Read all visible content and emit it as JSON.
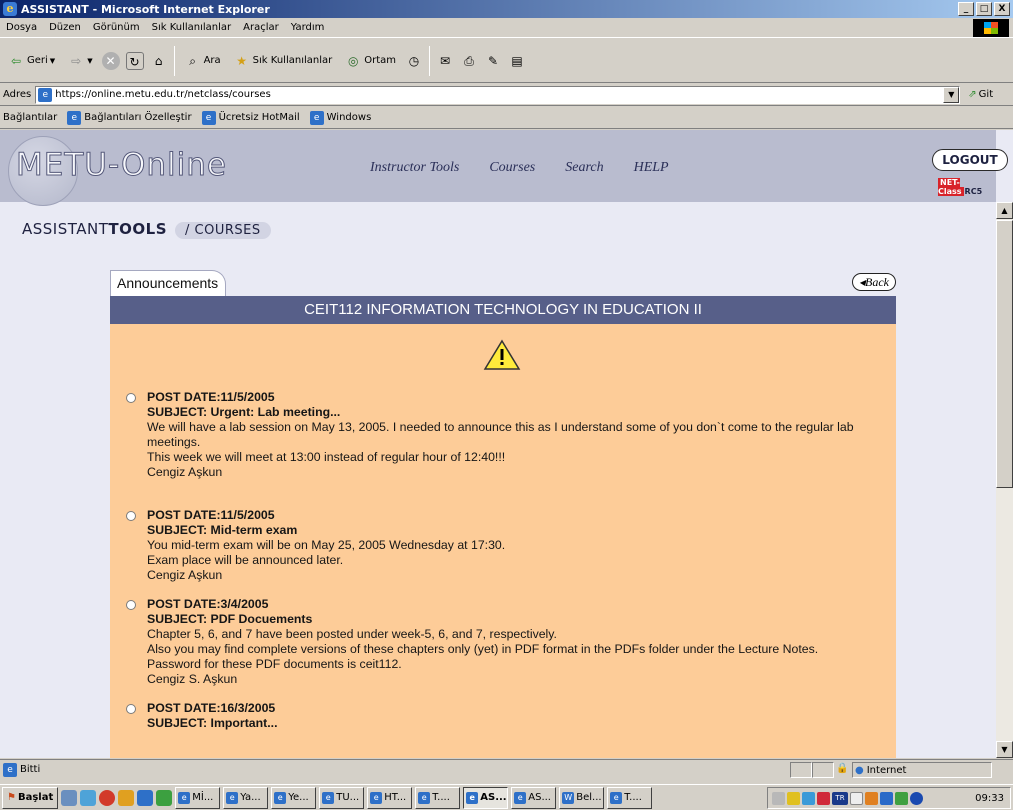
{
  "window": {
    "title": "ASSISTANT - Microsoft Internet Explorer",
    "min": "_",
    "max": "□",
    "close": "X"
  },
  "menu": [
    "Dosya",
    "Düzen",
    "Görünüm",
    "Sık Kullanılanlar",
    "Araçlar",
    "Yardım"
  ],
  "toolbar": {
    "back": "Geri",
    "search": "Ara",
    "favorites": "Sık Kullanılanlar",
    "media": "Ortam"
  },
  "address": {
    "label": "Adres",
    "url": "https://online.metu.edu.tr/netclass/courses",
    "go": "Git"
  },
  "links": {
    "label": "Bağlantılar",
    "items": [
      "Bağlantıları Özelleştir",
      "Ücretsiz HotMail",
      "Windows"
    ]
  },
  "header": {
    "logo": "METU-Online",
    "nav": [
      "Instructor Tools",
      "Courses",
      "Search",
      "HELP"
    ],
    "logout": "LOGOUT",
    "netclass": "NET-Class",
    "rc": "RC5"
  },
  "breadcrumb": {
    "part1": "ASSISTANT",
    "part2": "TOOLS",
    "current": "/ COURSES"
  },
  "tab": {
    "label": "Announcements"
  },
  "back": {
    "label": "◂Back"
  },
  "course": {
    "title": "CEIT112 INFORMATION TECHNOLOGY IN EDUCATION II"
  },
  "announcements": [
    {
      "date": "POST DATE:11/5/2005",
      "subject": "SUBJECT: Urgent: Lab meeting...",
      "lines": [
        "We will have a lab session on May 13, 2005. I needed to announce this as I understand some of you don`t come to the regular lab meetings.",
        "This week we will meet at 13:00 instead of regular hour of 12:40!!!",
        "Cengiz Aşkun"
      ]
    },
    {
      "date": "POST DATE:11/5/2005",
      "subject": "SUBJECT: Mid-term exam",
      "lines": [
        "You mid-term exam will be on May 25, 2005 Wednesday at 17:30.",
        "Exam place will be announced later.",
        "Cengiz Aşkun"
      ]
    },
    {
      "date": "POST DATE:3/4/2005",
      "subject": "SUBJECT: PDF Docuements",
      "lines": [
        "Chapter 5, 6, and 7 have been posted under week-5, 6, and 7, respectively.",
        "Also you may find complete versions of these chapters only (yet) in PDF format in the PDFs folder under the Lecture Notes.",
        "Password for these PDF documents is ceit112.",
        "Cengiz S. Aşkun"
      ]
    },
    {
      "date": "POST DATE:16/3/2005",
      "subject": "SUBJECT: Important...",
      "lines": []
    }
  ],
  "status": {
    "text": "Bitti",
    "zone": "Internet"
  },
  "taskbar": {
    "start": "Başlat",
    "buttons": [
      "Mİ...",
      "Ya...",
      "Ye...",
      "TU...",
      "HT...",
      "T....",
      "AS...",
      "AS...",
      "Bel...",
      "T...."
    ],
    "clock": "09:33",
    "lang": "TR"
  }
}
